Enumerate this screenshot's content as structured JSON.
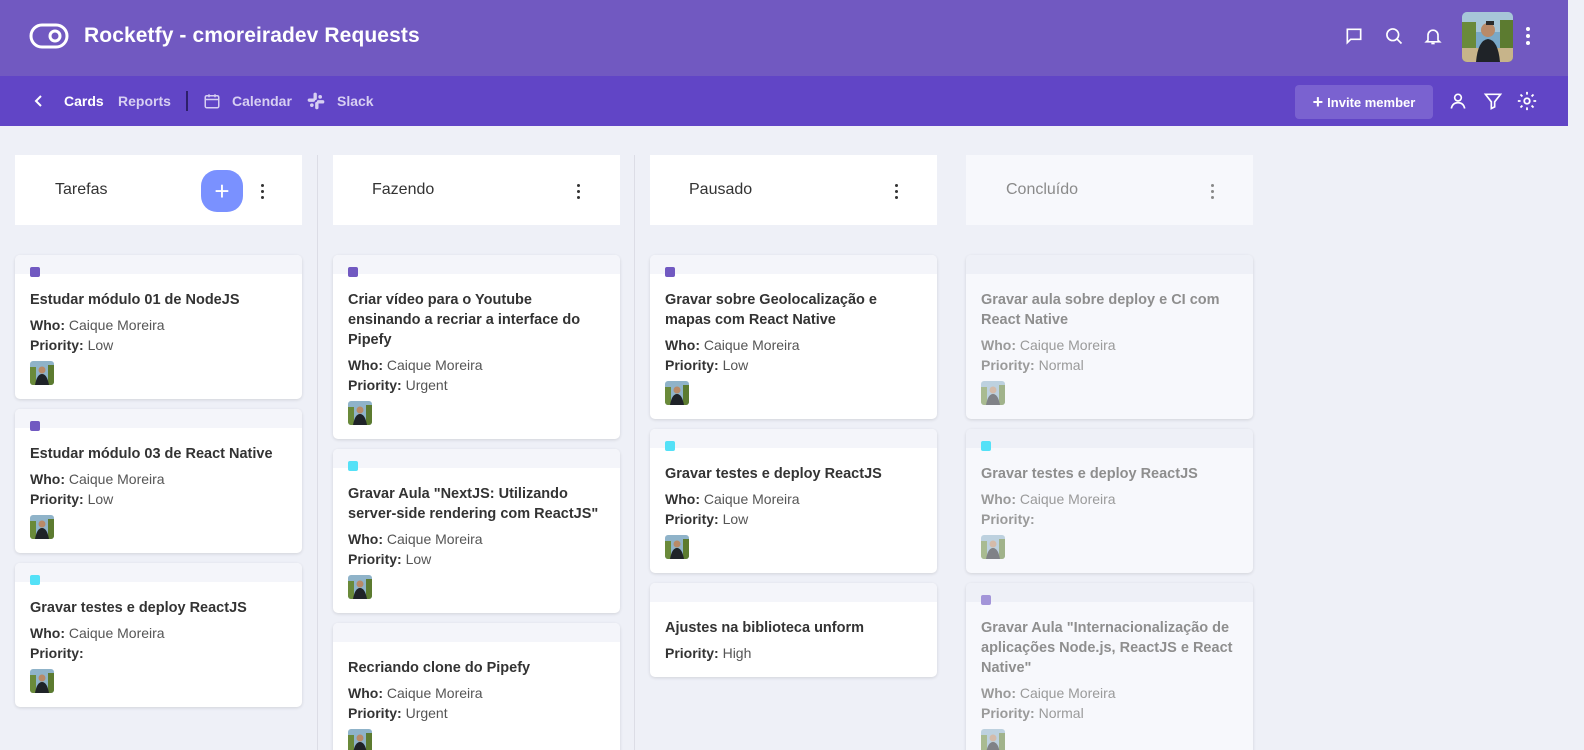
{
  "header": {
    "title": "Rocketfy - cmoreiradev Requests",
    "icons": [
      "message-icon",
      "search-icon",
      "bell-icon",
      "avatar",
      "more-vertical-icon"
    ],
    "bg_color": "#7159c1"
  },
  "subnav": {
    "cards": "Cards",
    "reports": "Reports",
    "calendar": "Calendar",
    "slack": "Slack",
    "invite": "Invite member",
    "bg_color": "#6145c6"
  },
  "colors": {
    "purple_label": "#7159c1",
    "cyan_label": "#54e1f7",
    "lilac_label": "#a395d9",
    "add_button": "#7a91ff"
  },
  "columns": [
    {
      "title": "Tarefas",
      "cards": [
        {
          "label": "purple",
          "title": "Estudar módulo 01 de NodeJS",
          "who_label": "Who:",
          "who": "Caique Moreira",
          "priority_label": "Priority:",
          "priority": "Low"
        },
        {
          "label": "purple",
          "title": "Estudar módulo 03 de React Native",
          "who_label": "Who:",
          "who": "Caique Moreira",
          "priority_label": "Priority:",
          "priority": "Low"
        },
        {
          "label": "cyan",
          "title": "Gravar testes e deploy ReactJS",
          "who_label": "Who:",
          "who": "Caique Moreira",
          "priority_label": "Priority:",
          "priority": ""
        }
      ]
    },
    {
      "title": "Fazendo",
      "cards": [
        {
          "label": "purple",
          "title": "Criar vídeo para o Youtube ensinando a recriar a interface do Pipefy",
          "who_label": "Who:",
          "who": "Caique Moreira",
          "priority_label": "Priority:",
          "priority": "Urgent"
        },
        {
          "label": "cyan",
          "title": "Gravar Aula \"NextJS: Utilizando server-side rendering com ReactJS\"",
          "who_label": "Who:",
          "who": "Caique Moreira",
          "priority_label": "Priority:",
          "priority": "Low"
        },
        {
          "label": "",
          "title": "Recriando clone do Pipefy",
          "who_label": "Who:",
          "who": "Caique Moreira",
          "priority_label": "Priority:",
          "priority": "Urgent"
        }
      ]
    },
    {
      "title": "Pausado",
      "cards": [
        {
          "label": "purple",
          "title": "Gravar sobre Geolocalização e mapas com React Native",
          "who_label": "Who:",
          "who": "Caique Moreira",
          "priority_label": "Priority:",
          "priority": "Low"
        },
        {
          "label": "cyan",
          "title": "Gravar testes e deploy ReactJS",
          "who_label": "Who:",
          "who": "Caique Moreira",
          "priority_label": "Priority:",
          "priority": "Low"
        },
        {
          "label": "",
          "title": "Ajustes na biblioteca unform",
          "priority_label": "Priority:",
          "priority": "High"
        }
      ]
    },
    {
      "title": "Concluído",
      "cards": [
        {
          "label": "",
          "title": "Gravar aula sobre deploy e CI com React Native",
          "who_label": "Who:",
          "who": "Caique Moreira",
          "priority_label": "Priority:",
          "priority": "Normal"
        },
        {
          "label": "cyan",
          "title": "Gravar testes e deploy ReactJS",
          "who_label": "Who:",
          "who": "Caique Moreira",
          "priority_label": "Priority:",
          "priority": ""
        },
        {
          "label": "lilac",
          "title": "Gravar Aula \"Internacionalização de aplicações Node.js, ReactJS e React Native\"",
          "who_label": "Who:",
          "who": "Caique Moreira",
          "priority_label": "Priority:",
          "priority": "Normal"
        }
      ]
    }
  ]
}
